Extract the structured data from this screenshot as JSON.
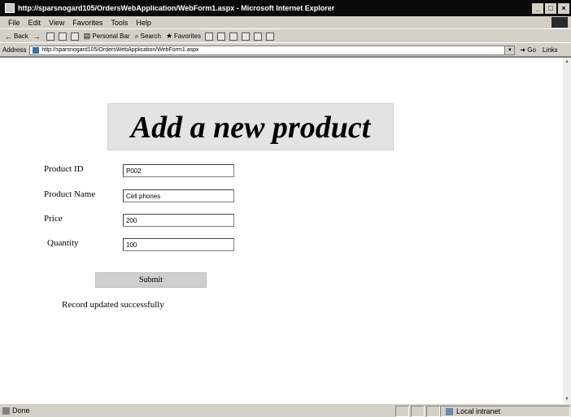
{
  "window": {
    "title": "http://sparsnogard105/OrdersWebApplication/WebForm1.aspx - Microsoft Internet Explorer",
    "buttons": [
      "_",
      "□",
      "×"
    ]
  },
  "menu": [
    "File",
    "Edit",
    "View",
    "Favorites",
    "Tools",
    "Help"
  ],
  "toolbar": {
    "back": "Back",
    "personal_bar": "Personal Bar",
    "search": "Search",
    "favorites": "Favorites"
  },
  "address": {
    "label": "Address",
    "url": "http://sparsnogard105/OrdersWebApplication/WebForm1.aspx",
    "go": "Go",
    "links": "Links"
  },
  "page": {
    "heading": "Add a new product",
    "form": {
      "product_id": {
        "label": "Product ID",
        "value": "P002"
      },
      "product_name": {
        "label": "Product Name",
        "value": "Cell phones"
      },
      "price": {
        "label": "Price",
        "value": "200"
      },
      "quantity": {
        "label": "Quantity",
        "value": "100"
      }
    },
    "submit": "Submit",
    "message": "Record updated successfully"
  },
  "status": {
    "text": "Done",
    "zone": "Local intranet"
  },
  "colors": {
    "titlebar": "#0a0a0a",
    "chrome": "#d4d0c8",
    "heading_bg": "#e3e3e3",
    "button_bg": "#cfcfcf"
  }
}
